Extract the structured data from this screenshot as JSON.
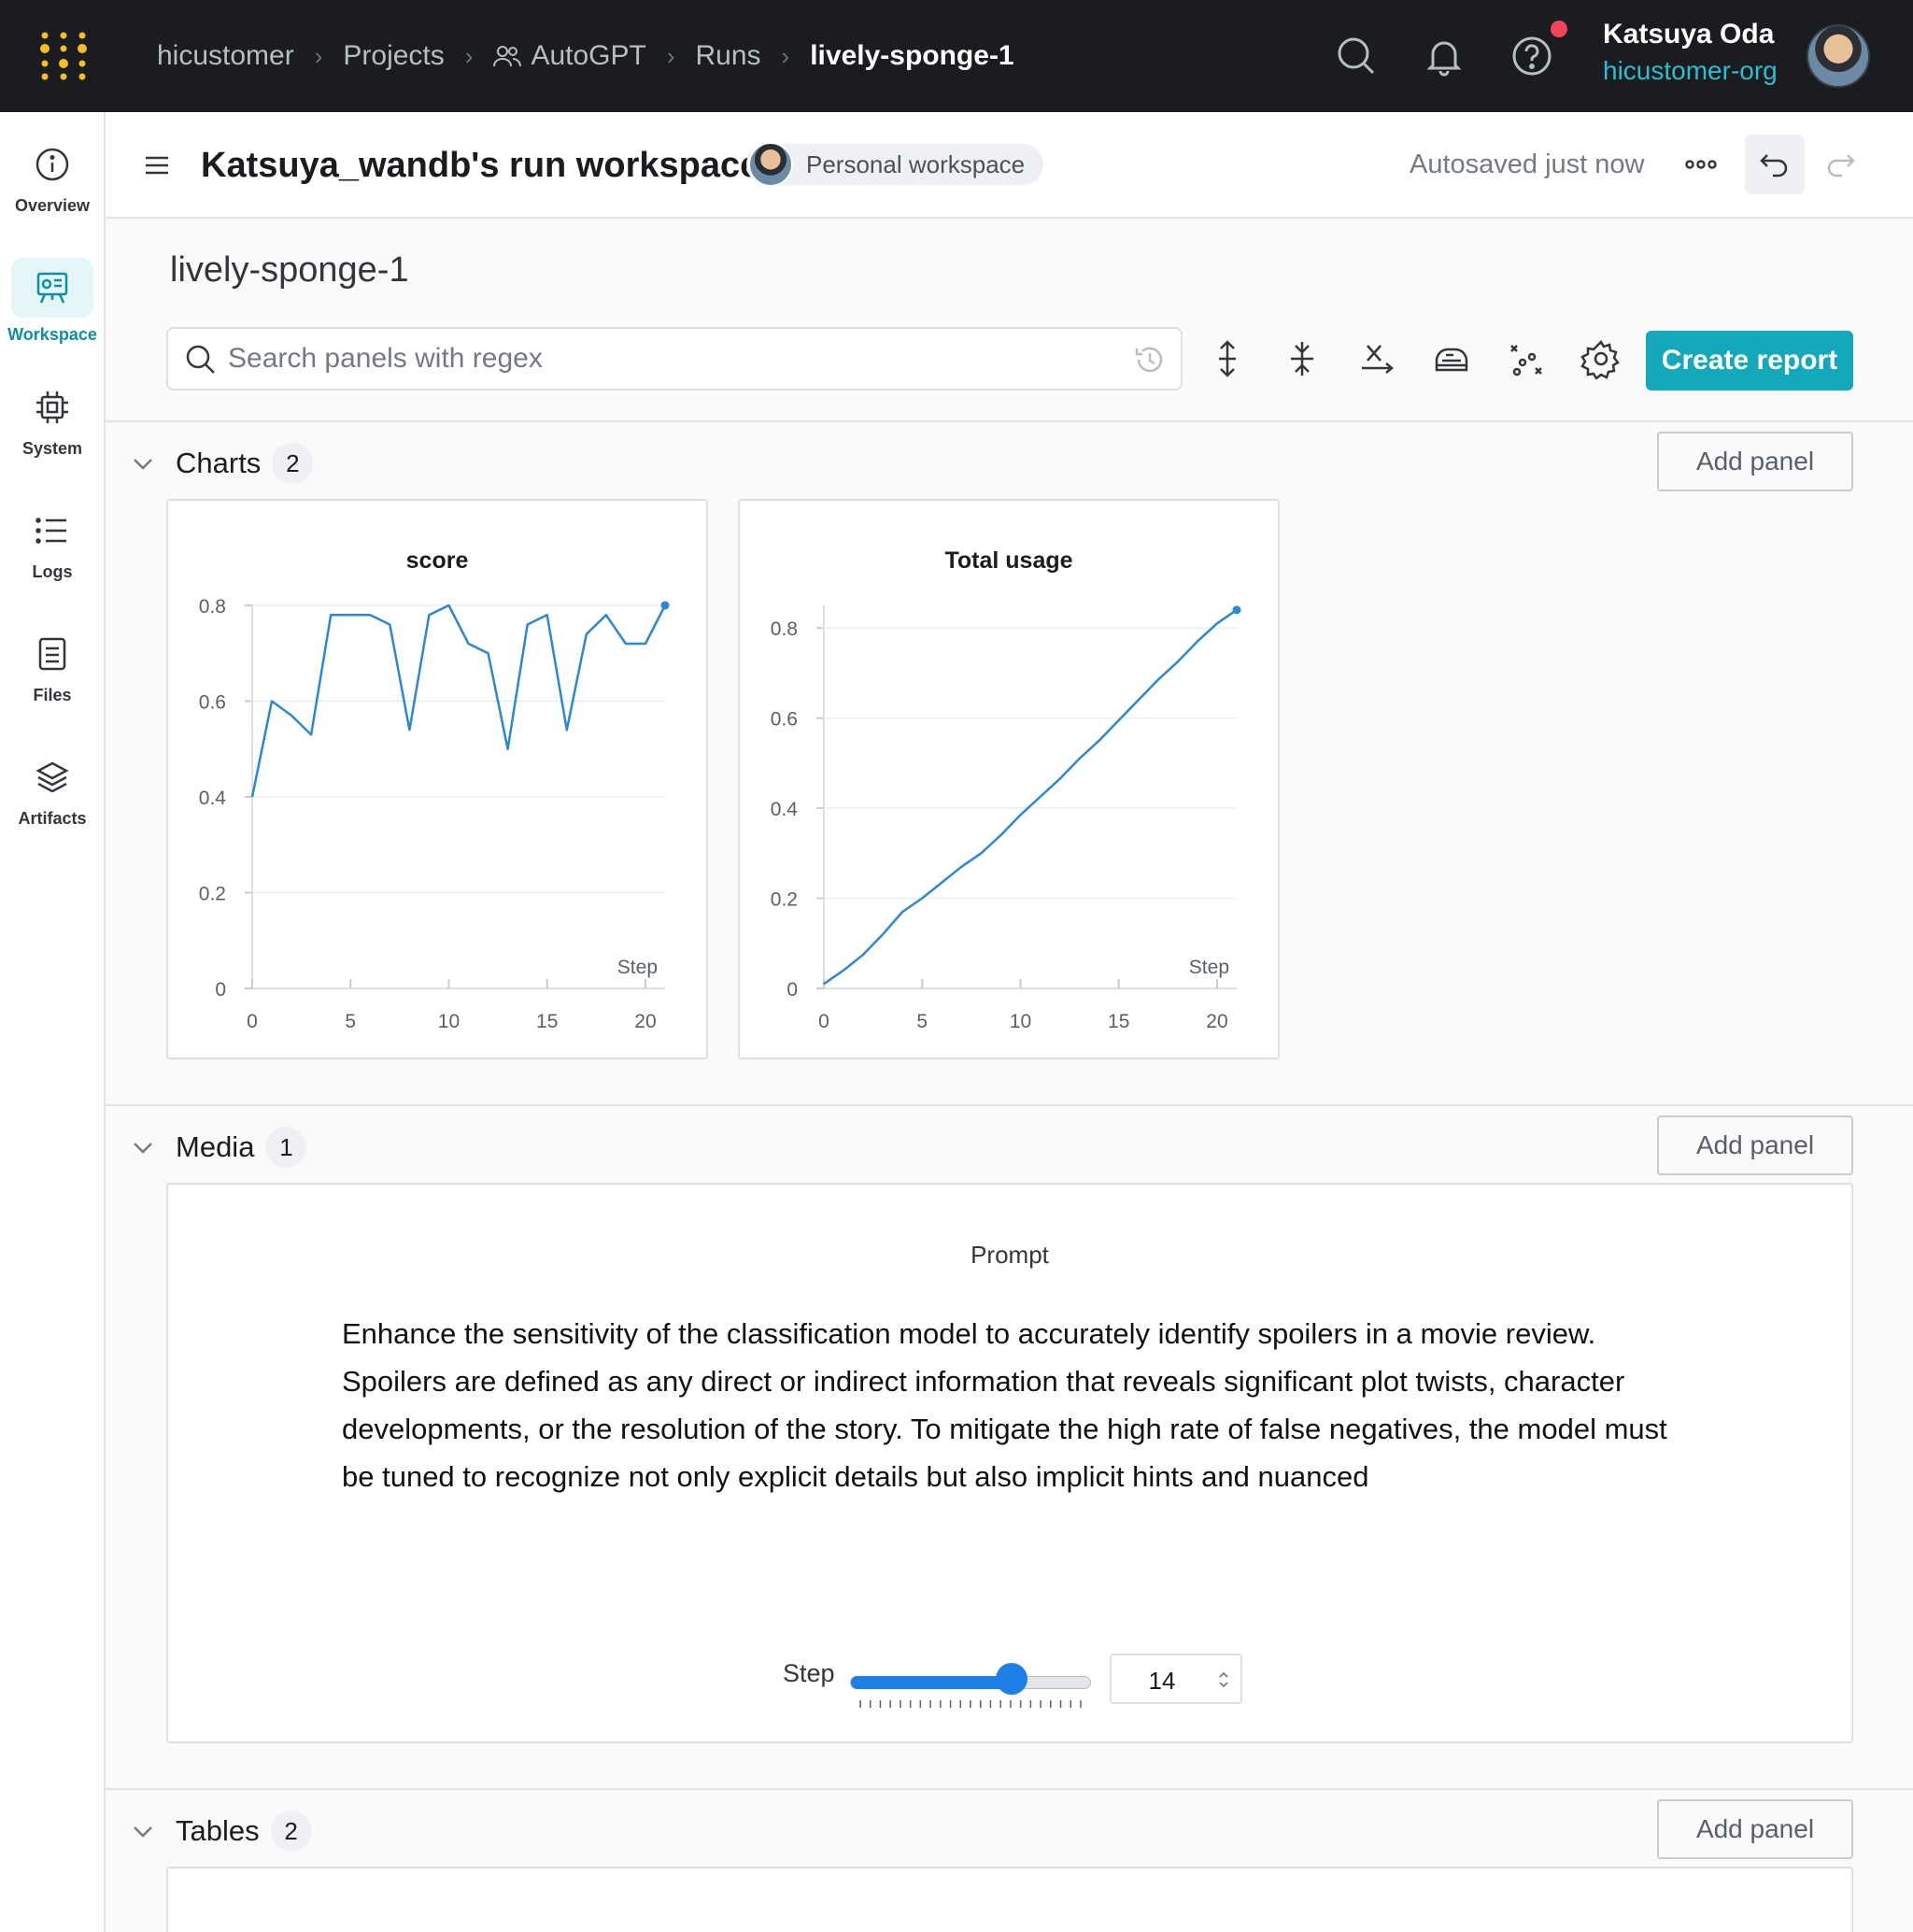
{
  "topbar": {
    "breadcrumbs": [
      "hicustomer",
      "Projects",
      "AutoGPT",
      "Runs",
      "lively-sponge-1"
    ],
    "user_name": "Katsuya Oda",
    "user_org": "hicustomer-org"
  },
  "sidebar": {
    "items": [
      {
        "label": "Overview",
        "icon": "info-icon"
      },
      {
        "label": "Workspace",
        "icon": "workspace-icon",
        "active": true
      },
      {
        "label": "System",
        "icon": "chip-icon"
      },
      {
        "label": "Logs",
        "icon": "list-icon"
      },
      {
        "label": "Files",
        "icon": "file-icon"
      },
      {
        "label": "Artifacts",
        "icon": "layers-icon"
      }
    ]
  },
  "workspace": {
    "title": "Katsuya_wandb's run workspace",
    "badge": "Personal workspace",
    "autosave": "Autosaved just now"
  },
  "run": {
    "name": "lively-sponge-1",
    "search_placeholder": "Search panels with regex",
    "create_report": "Create report"
  },
  "sections": {
    "charts": {
      "title": "Charts",
      "count": "2",
      "add_panel": "Add panel"
    },
    "media": {
      "title": "Media",
      "count": "1",
      "add_panel": "Add panel"
    },
    "tables": {
      "title": "Tables",
      "count": "2",
      "add_panel": "Add panel"
    }
  },
  "media_panel": {
    "title": "Prompt",
    "text": "Enhance the sensitivity of the classification model to accurately identify spoilers in a movie review. Spoilers are defined as any direct or indirect information that reveals significant plot twists, character developments, or the resolution of the story. To mitigate the high rate of false negatives, the model must be tuned to recognize not only explicit details but also implicit hints and nuanced",
    "step_label": "Step",
    "step_value": "14",
    "step_fraction": 0.67
  },
  "colors": {
    "accent": "#13a9ba",
    "line": "#2d87d3",
    "topbar": "#1a1c1f"
  },
  "chart_data": [
    {
      "type": "line",
      "title": "score",
      "xlabel": "Step",
      "xlim": [
        0,
        21
      ],
      "ylim": [
        0,
        0.8
      ],
      "xticks": [
        0,
        5,
        10,
        15,
        20
      ],
      "yticks": [
        0,
        0.2,
        0.4,
        0.6,
        0.8
      ],
      "x": [
        0,
        1,
        2,
        3,
        4,
        5,
        6,
        7,
        8,
        9,
        10,
        11,
        12,
        13,
        14,
        15,
        16,
        17,
        18,
        19,
        20,
        21
      ],
      "y": [
        0.4,
        0.6,
        0.57,
        0.53,
        0.78,
        0.78,
        0.78,
        0.76,
        0.54,
        0.78,
        0.8,
        0.72,
        0.7,
        0.5,
        0.76,
        0.78,
        0.54,
        0.74,
        0.78,
        0.72,
        0.72,
        0.8
      ]
    },
    {
      "type": "line",
      "title": "Total usage",
      "xlabel": "Step",
      "xlim": [
        0,
        21
      ],
      "ylim": [
        0,
        0.85
      ],
      "xticks": [
        0,
        5,
        10,
        15,
        20
      ],
      "yticks": [
        0,
        0.2,
        0.4,
        0.6,
        0.8
      ],
      "x": [
        0,
        1,
        2,
        3,
        4,
        5,
        6,
        7,
        8,
        9,
        10,
        11,
        12,
        13,
        14,
        15,
        16,
        17,
        18,
        19,
        20,
        21
      ],
      "y": [
        0.01,
        0.04,
        0.075,
        0.12,
        0.17,
        0.2,
        0.235,
        0.27,
        0.3,
        0.34,
        0.385,
        0.425,
        0.465,
        0.51,
        0.55,
        0.595,
        0.64,
        0.685,
        0.725,
        0.77,
        0.81,
        0.84
      ]
    }
  ]
}
